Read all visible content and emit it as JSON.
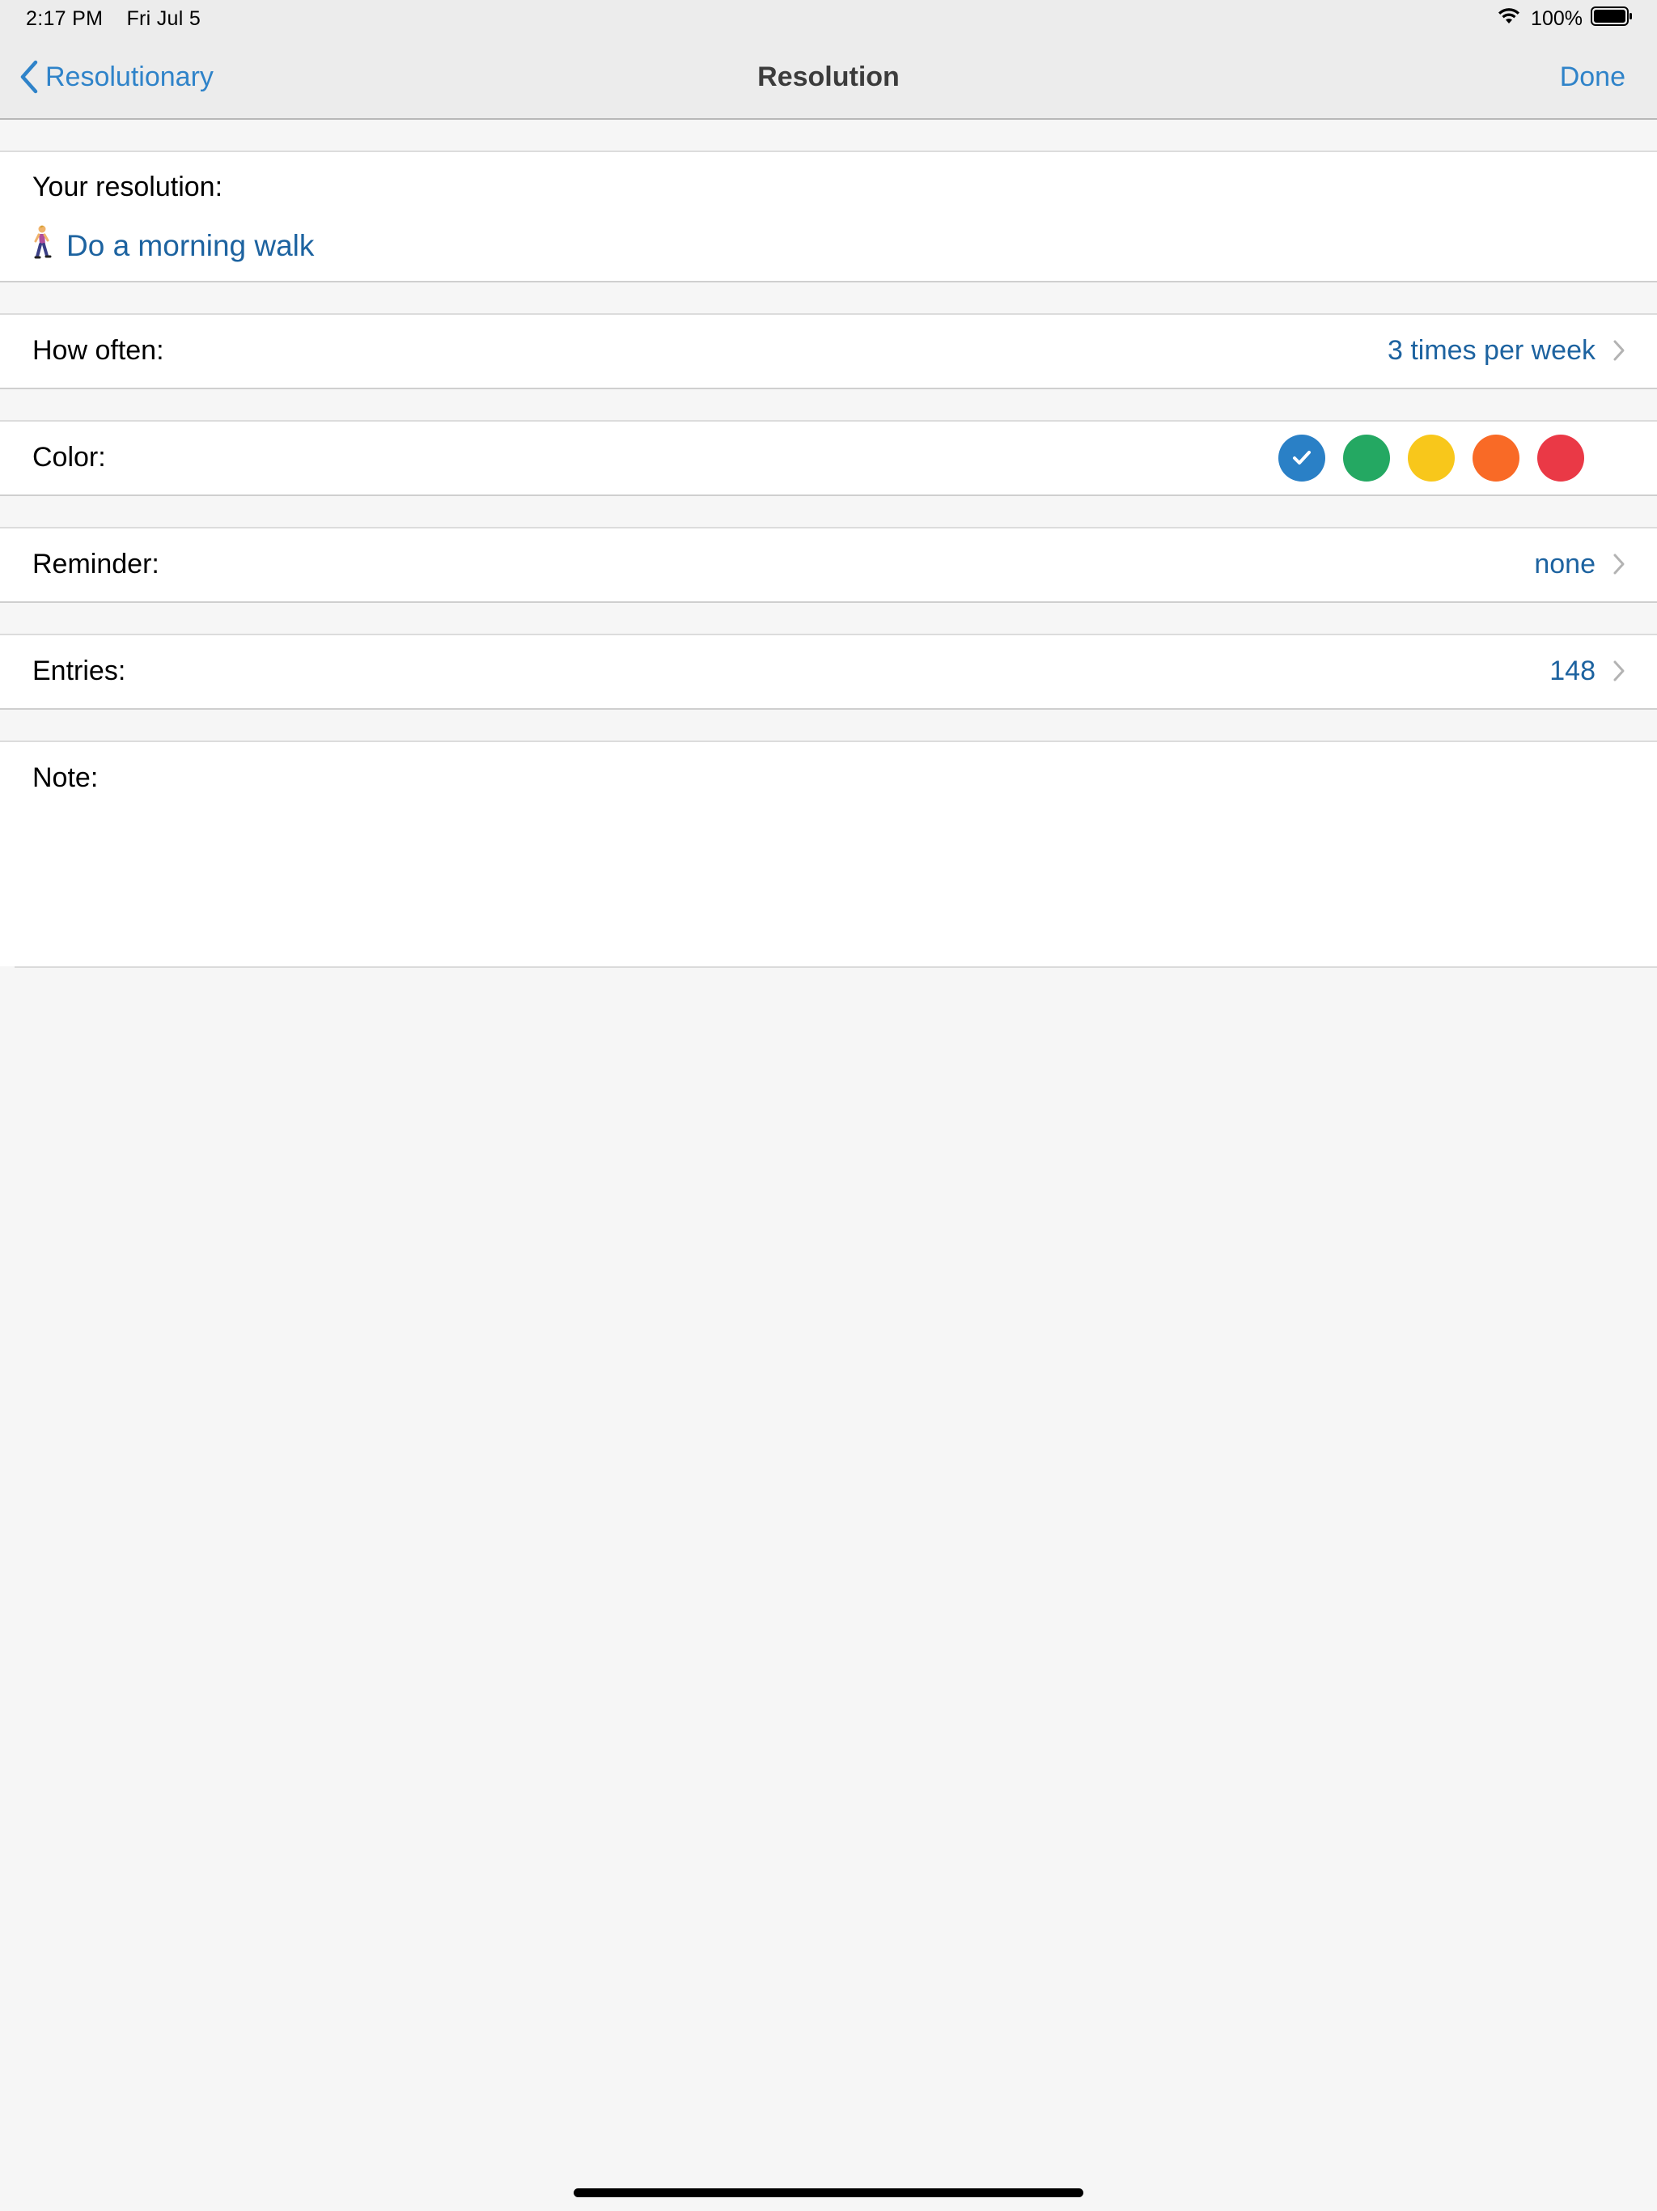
{
  "status_bar": {
    "time": "2:17 PM",
    "date": "Fri Jul 5",
    "battery": "100%",
    "icons": [
      "wifi-icon",
      "battery-icon"
    ]
  },
  "nav": {
    "back_label": "Resolutionary",
    "title": "Resolution",
    "done_label": "Done"
  },
  "resolution": {
    "label": "Your resolution:",
    "text": "Do a morning walk",
    "emoji_icon": "person-walking-icon"
  },
  "how_often": {
    "label": "How often:",
    "value": "3 times per week"
  },
  "color": {
    "label": "Color:",
    "options": [
      {
        "name": "blue",
        "hex": "#2a80c6",
        "selected": true
      },
      {
        "name": "green",
        "hex": "#24a862"
      },
      {
        "name": "yellow",
        "hex": "#f8c71b"
      },
      {
        "name": "orange",
        "hex": "#f96a26"
      },
      {
        "name": "red",
        "hex": "#ea3946"
      }
    ]
  },
  "reminder": {
    "label": "Reminder:",
    "value": "none"
  },
  "entries": {
    "label": "Entries:",
    "value": "148"
  },
  "note": {
    "label": "Note:",
    "value": ""
  },
  "colors": {
    "accent": "#2f83c9",
    "value_text": "#1d63a0",
    "background": "#f6f6f6",
    "bar": "#ececec"
  }
}
